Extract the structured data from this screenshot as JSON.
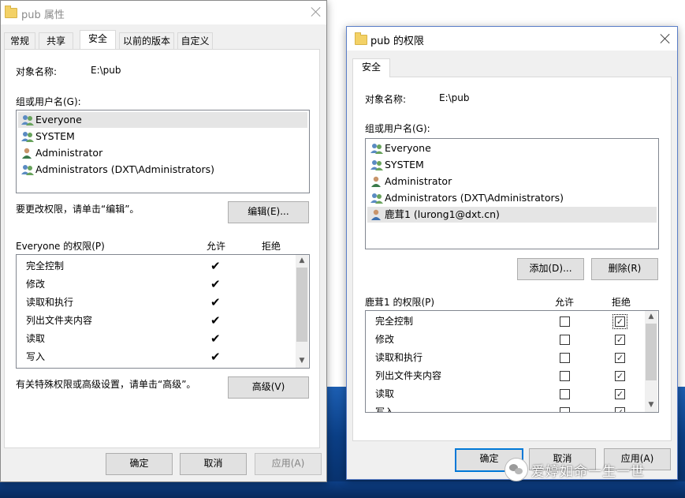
{
  "left_window": {
    "title": "pub 属性",
    "tabs": [
      "常规",
      "共享",
      "安全",
      "以前的版本",
      "自定义"
    ],
    "active_tab": "安全",
    "object_name_label": "对象名称:",
    "object_name_value": "E:\\pub",
    "groups_label": "组或用户名(G):",
    "users": [
      {
        "name": "Everyone",
        "icon": "group-icon",
        "selected": true
      },
      {
        "name": "SYSTEM",
        "icon": "group-icon",
        "selected": false
      },
      {
        "name": "Administrator",
        "icon": "user-icon",
        "selected": false
      },
      {
        "name": "Administrators (DXT\\Administrators)",
        "icon": "group-icon",
        "selected": false
      }
    ],
    "edit_hint": "要更改权限，请单击“编辑”。",
    "edit_button": "编辑(E)...",
    "perm_label": "Everyone 的权限(P)",
    "allow_header": "允许",
    "deny_header": "拒绝",
    "permissions": [
      {
        "name": "完全控制",
        "allow": true,
        "deny": false
      },
      {
        "name": "修改",
        "allow": true,
        "deny": false
      },
      {
        "name": "读取和执行",
        "allow": true,
        "deny": false
      },
      {
        "name": "列出文件夹内容",
        "allow": true,
        "deny": false
      },
      {
        "name": "读取",
        "allow": true,
        "deny": false
      },
      {
        "name": "写入",
        "allow": true,
        "deny": false
      }
    ],
    "advanced_hint": "有关特殊权限或高级设置，请单击“高级”。",
    "advanced_button": "高级(V)",
    "ok_button": "确定",
    "cancel_button": "取消",
    "apply_button": "应用(A)"
  },
  "right_window": {
    "title": "pub 的权限",
    "tab": "安全",
    "object_name_label": "对象名称:",
    "object_name_value": "E:\\pub",
    "groups_label": "组或用户名(G):",
    "users": [
      {
        "name": "Everyone",
        "icon": "group-icon",
        "selected": false
      },
      {
        "name": "SYSTEM",
        "icon": "group-icon",
        "selected": false
      },
      {
        "name": "Administrator",
        "icon": "user-icon",
        "selected": false
      },
      {
        "name": "Administrators (DXT\\Administrators)",
        "icon": "group-icon",
        "selected": false
      },
      {
        "name": "鹿茸1 (lurong1@dxt.cn)",
        "icon": "user-icon",
        "selected": true
      }
    ],
    "add_button": "添加(D)...",
    "remove_button": "删除(R)",
    "perm_label": "鹿茸1 的权限(P)",
    "allow_header": "允许",
    "deny_header": "拒绝",
    "permissions": [
      {
        "name": "完全控制",
        "allow": false,
        "deny": true
      },
      {
        "name": "修改",
        "allow": false,
        "deny": true
      },
      {
        "name": "读取和执行",
        "allow": false,
        "deny": true
      },
      {
        "name": "列出文件夹内容",
        "allow": false,
        "deny": true
      },
      {
        "name": "读取",
        "allow": false,
        "deny": true
      },
      {
        "name": "写入",
        "allow": false,
        "deny": true
      }
    ],
    "ok_button": "确定",
    "cancel_button": "取消",
    "apply_button": "应用(A)"
  },
  "watermark": "爱婷如命一生一世",
  "colors": {
    "focus_blue": "#0078d7",
    "selection": "#e5e5e5",
    "dialog_bg": "#f0f0f0"
  }
}
